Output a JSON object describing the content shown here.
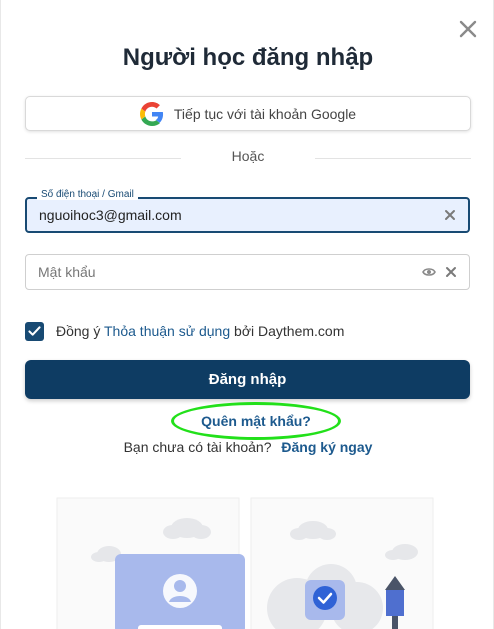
{
  "modal": {
    "title": "Người học đăng nhập"
  },
  "google": {
    "label": "Tiếp tục với tài khoản Google"
  },
  "divider": {
    "text": "Hoặc"
  },
  "phone": {
    "label": "Số điện thoại / Gmail",
    "value": "nguoihoc3@gmail.com"
  },
  "password": {
    "placeholder": "Mật khẩu"
  },
  "agree": {
    "checked": true,
    "prefix": "Đồng ý",
    "link": "Thỏa thuận sử dụng",
    "suffix": "bởi Daythem.com"
  },
  "login": {
    "label": "Đăng nhập"
  },
  "forgot": {
    "label": "Quên mật khẩu?"
  },
  "signup": {
    "prompt": "Bạn chưa có tài khoản?",
    "link": "Đăng ký ngay"
  },
  "colors": {
    "primary": "#0e3c63",
    "link": "#1d5a8e",
    "highlight_ring": "#22e01a",
    "input_active_bg": "#e8f0fe"
  },
  "icons": [
    "close-icon",
    "google-icon",
    "clear-icon",
    "eye-icon",
    "checkmark-icon"
  ]
}
